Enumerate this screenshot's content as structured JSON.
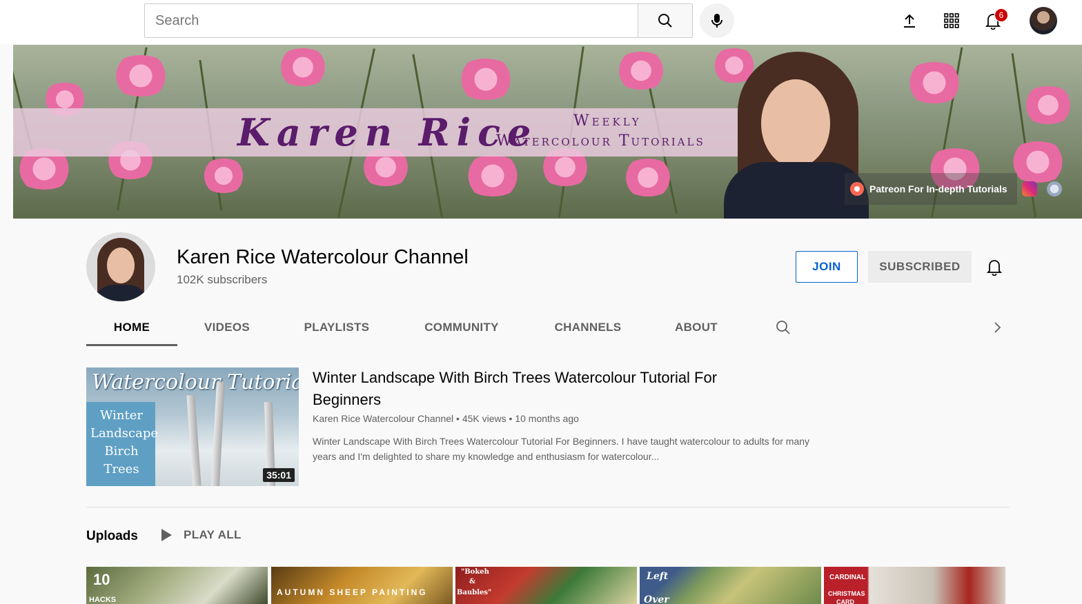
{
  "topbar": {
    "search_placeholder": "Search",
    "notification_count": "6"
  },
  "banner": {
    "name": "Karen Rice",
    "line1": "Weekly",
    "line2": "Watercolour Tutorials",
    "link_text": "Patreon For In-depth Tutorials"
  },
  "channel": {
    "title": "Karen Rice Watercolour Channel",
    "subscribers": "102K subscribers",
    "join_label": "JOIN",
    "subscribed_label": "SUBSCRIBED"
  },
  "tabs": [
    {
      "label": "HOME",
      "active": true
    },
    {
      "label": "VIDEOS"
    },
    {
      "label": "PLAYLISTS"
    },
    {
      "label": "COMMUNITY"
    },
    {
      "label": "CHANNELS"
    },
    {
      "label": "ABOUT"
    }
  ],
  "featured": {
    "thumb_headline": "Watercolour Tutorial",
    "thumb_sub": [
      "Winter",
      "Landscape",
      "Birch",
      "Trees"
    ],
    "duration": "35:01",
    "title": "Winter Landscape With Birch Trees Watercolour Tutorial For Beginners",
    "channel": "Karen Rice Watercolour Channel",
    "views": "45K views",
    "age": "10 months ago",
    "description": "Winter Landscape With Birch Trees Watercolour Tutorial For Beginners. I have taught watercolour to adults for many years and I'm delighted to share my knowledge and enthusiasm for watercolour..."
  },
  "uploads": {
    "label": "Uploads",
    "play_all": "PLAY ALL",
    "thumbs": [
      {
        "text": "10",
        "text2": "HACKS"
      },
      {
        "text": "AUTUMN SHEEP PAINTING"
      },
      {
        "text": "\"Bokeh",
        "text2": "&",
        "text3": "Baubles\""
      },
      {
        "text": "Left",
        "text2": "Over"
      },
      {
        "text": "CARDINAL",
        "text2": "CHRISTMAS",
        "text3": "CARD"
      }
    ]
  },
  "colors": {
    "accent_blue": "#065fd4",
    "badge_red": "#cc0000",
    "banner_text": "#5a1c6b"
  }
}
